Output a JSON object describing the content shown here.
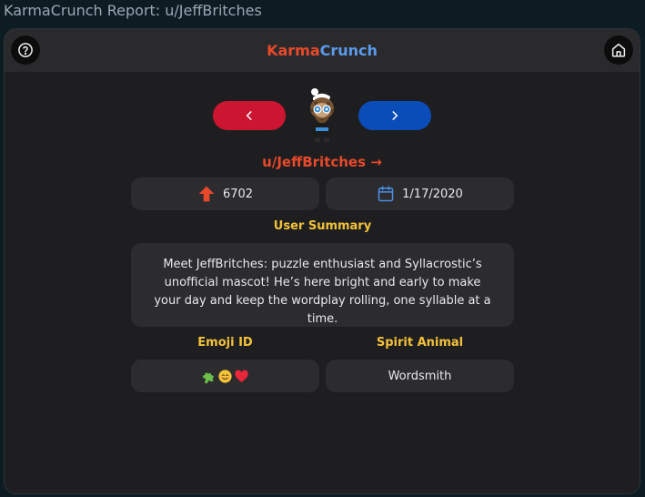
{
  "window": {
    "title": "KarmaCrunch Report: u/JeffBritches"
  },
  "header": {
    "brand_part1": "Karma",
    "brand_part2": "Crunch",
    "help_icon": "help-circle-icon",
    "home_icon": "home-icon"
  },
  "navigation": {
    "prev_icon": "chevron-left-icon",
    "next_icon": "chevron-right-icon"
  },
  "profile": {
    "username": "u/JeffBritches →",
    "karma": "6702",
    "karma_icon": "upvote-arrow-icon",
    "cake_day": "1/17/2020",
    "cake_day_icon": "calendar-icon"
  },
  "summary": {
    "label": "User Summary",
    "text": "Meet JeffBritches: puzzle enthusiast and Syllacrostic’s unofficial mascot! He’s here bright and early to make your day and keep the wordplay rolling, one syllable at a time."
  },
  "emoji_id": {
    "label": "Emoji ID",
    "icons": [
      "puzzle-piece-icon",
      "smiling-face-icon",
      "red-heart-icon"
    ]
  },
  "spirit_animal": {
    "label": "Spirit Animal",
    "value": "Wordsmith"
  },
  "colors": {
    "accent_red": "#e8492b",
    "accent_blue": "#5b9bea",
    "label_yellow": "#f2c23a",
    "prev_button": "#cc1530",
    "next_button": "#0b4db8",
    "card_bg": "#1e1e20",
    "pill_bg": "#2c2c2f"
  }
}
